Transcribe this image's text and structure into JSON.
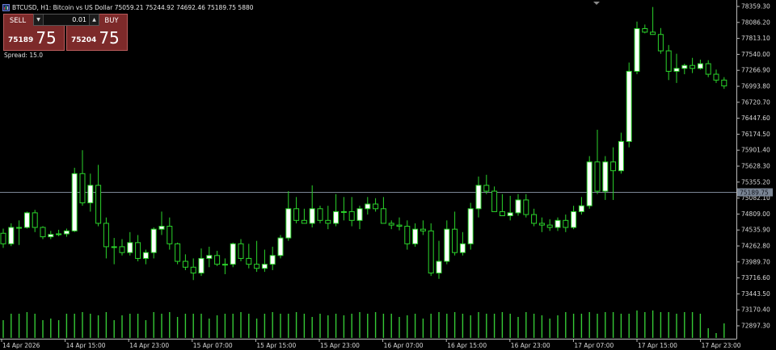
{
  "window": {
    "symbol": "BTCUSD, H1:",
    "description": "Bitcoin vs US Dollar",
    "ohlc": "75059.21 75244.92 74692.46 75189.75",
    "volume": "5880"
  },
  "trade_panel": {
    "sell_label": "SELL",
    "buy_label": "BUY",
    "lot": "0.01",
    "sell_price_small": "75189",
    "sell_price_big": "75",
    "buy_price_small": "75204",
    "buy_price_big": "75",
    "spread": "Spread: 15.0"
  },
  "colors": {
    "background": "#000000",
    "bull_fill": "#ffffff",
    "bear_fill": "#000000",
    "candle_outline": "#2bd42b",
    "volume": "#35c935",
    "price_line": "#7b8695",
    "panel_red": "#7d2a2a"
  },
  "axis": {
    "price_ticks": [
      "78359.30",
      "78086.20",
      "77813.10",
      "77540.00",
      "77266.90",
      "76993.80",
      "76720.70",
      "76447.60",
      "76174.50",
      "75901.40",
      "75628.30",
      "75355.20",
      "75082.10",
      "74809.00",
      "74535.90",
      "74262.80",
      "73989.70",
      "73716.60",
      "73443.50",
      "73170.40",
      "72897.30"
    ],
    "current_price_label": "75189.75",
    "time_labels": [
      "14 Apr 2026",
      "14 Apr 15:00",
      "14 Apr 23:00",
      "15 Apr 07:00",
      "15 Apr 15:00",
      "15 Apr 23:00",
      "16 Apr 07:00",
      "16 Apr 15:00",
      "16 Apr 23:00",
      "17 Apr 07:00",
      "17 Apr 15:00",
      "17 Apr 23:00"
    ]
  },
  "chart_data": {
    "type": "candlestick",
    "timeframe": "H1",
    "current_price": 75189.75,
    "ylim": [
      72897.3,
      78359.3
    ],
    "candles": [
      {
        "o": 74480,
        "h": 74560,
        "l": 74230,
        "c": 74300
      },
      {
        "o": 74300,
        "h": 74650,
        "l": 74260,
        "c": 74580
      },
      {
        "o": 74580,
        "h": 74700,
        "l": 74280,
        "c": 74580
      },
      {
        "o": 74580,
        "h": 74850,
        "l": 74560,
        "c": 74830
      },
      {
        "o": 74830,
        "h": 74880,
        "l": 74500,
        "c": 74580
      },
      {
        "o": 74580,
        "h": 74600,
        "l": 74380,
        "c": 74420
      },
      {
        "o": 74420,
        "h": 74520,
        "l": 74380,
        "c": 74460
      },
      {
        "o": 74460,
        "h": 74540,
        "l": 74430,
        "c": 74470
      },
      {
        "o": 74470,
        "h": 74560,
        "l": 74420,
        "c": 74520
      },
      {
        "o": 74520,
        "h": 75600,
        "l": 74500,
        "c": 75500
      },
      {
        "o": 75500,
        "h": 75900,
        "l": 74950,
        "c": 75000
      },
      {
        "o": 75000,
        "h": 75500,
        "l": 74850,
        "c": 75300
      },
      {
        "o": 75300,
        "h": 75650,
        "l": 74600,
        "c": 74650
      },
      {
        "o": 74650,
        "h": 74750,
        "l": 74050,
        "c": 74250
      },
      {
        "o": 74250,
        "h": 74400,
        "l": 73950,
        "c": 74250
      },
      {
        "o": 74250,
        "h": 74380,
        "l": 74100,
        "c": 74150
      },
      {
        "o": 74150,
        "h": 74500,
        "l": 74100,
        "c": 74320
      },
      {
        "o": 74320,
        "h": 74450,
        "l": 74000,
        "c": 74050
      },
      {
        "o": 74050,
        "h": 74200,
        "l": 73950,
        "c": 74150
      },
      {
        "o": 74150,
        "h": 74580,
        "l": 74050,
        "c": 74550
      },
      {
        "o": 74550,
        "h": 74850,
        "l": 74450,
        "c": 74600
      },
      {
        "o": 74600,
        "h": 74750,
        "l": 74200,
        "c": 74300
      },
      {
        "o": 74300,
        "h": 74320,
        "l": 73950,
        "c": 74000
      },
      {
        "o": 74000,
        "h": 74120,
        "l": 73850,
        "c": 73900
      },
      {
        "o": 73900,
        "h": 74050,
        "l": 73680,
        "c": 73800
      },
      {
        "o": 73800,
        "h": 74220,
        "l": 73750,
        "c": 74050
      },
      {
        "o": 74050,
        "h": 74250,
        "l": 73900,
        "c": 74100
      },
      {
        "o": 74100,
        "h": 74180,
        "l": 73920,
        "c": 73950
      },
      {
        "o": 73950,
        "h": 74050,
        "l": 73780,
        "c": 73950
      },
      {
        "o": 73950,
        "h": 74320,
        "l": 73900,
        "c": 74300
      },
      {
        "o": 74300,
        "h": 74380,
        "l": 74000,
        "c": 74050
      },
      {
        "o": 74050,
        "h": 74300,
        "l": 73880,
        "c": 73950
      },
      {
        "o": 73950,
        "h": 74350,
        "l": 73820,
        "c": 73880
      },
      {
        "o": 73880,
        "h": 74200,
        "l": 73820,
        "c": 73950
      },
      {
        "o": 73950,
        "h": 74250,
        "l": 73850,
        "c": 74100
      },
      {
        "o": 74100,
        "h": 74450,
        "l": 74050,
        "c": 74400
      },
      {
        "o": 74400,
        "h": 75200,
        "l": 74350,
        "c": 74900
      },
      {
        "o": 74900,
        "h": 75100,
        "l": 74650,
        "c": 74700
      },
      {
        "o": 74700,
        "h": 74900,
        "l": 74650,
        "c": 74650
      },
      {
        "o": 74650,
        "h": 75300,
        "l": 74580,
        "c": 74900
      },
      {
        "o": 74900,
        "h": 74950,
        "l": 74650,
        "c": 74700
      },
      {
        "o": 74700,
        "h": 74950,
        "l": 74550,
        "c": 74650
      },
      {
        "o": 74650,
        "h": 75150,
        "l": 74600,
        "c": 74850
      },
      {
        "o": 74850,
        "h": 75100,
        "l": 74700,
        "c": 74850
      },
      {
        "o": 74850,
        "h": 75100,
        "l": 74600,
        "c": 74700
      },
      {
        "o": 74700,
        "h": 74950,
        "l": 74550,
        "c": 74900
      },
      {
        "o": 74900,
        "h": 75100,
        "l": 74800,
        "c": 74980
      },
      {
        "o": 74980,
        "h": 75080,
        "l": 74850,
        "c": 74900
      },
      {
        "o": 74900,
        "h": 75100,
        "l": 74650,
        "c": 74650
      },
      {
        "o": 74650,
        "h": 74700,
        "l": 74550,
        "c": 74620
      },
      {
        "o": 74620,
        "h": 74750,
        "l": 74530,
        "c": 74600
      },
      {
        "o": 74600,
        "h": 74700,
        "l": 74200,
        "c": 74300
      },
      {
        "o": 74300,
        "h": 74650,
        "l": 74250,
        "c": 74550
      },
      {
        "o": 74550,
        "h": 74700,
        "l": 74450,
        "c": 74520
      },
      {
        "o": 74520,
        "h": 74650,
        "l": 73750,
        "c": 73800
      },
      {
        "o": 73800,
        "h": 74350,
        "l": 73700,
        "c": 74000
      },
      {
        "o": 74000,
        "h": 74700,
        "l": 73950,
        "c": 74550
      },
      {
        "o": 74550,
        "h": 74850,
        "l": 74100,
        "c": 74150
      },
      {
        "o": 74150,
        "h": 74500,
        "l": 74100,
        "c": 74300
      },
      {
        "o": 74300,
        "h": 75000,
        "l": 74200,
        "c": 74900
      },
      {
        "o": 74900,
        "h": 75450,
        "l": 74750,
        "c": 75300
      },
      {
        "o": 75300,
        "h": 75480,
        "l": 75150,
        "c": 75200
      },
      {
        "o": 75200,
        "h": 75280,
        "l": 74850,
        "c": 74850
      },
      {
        "o": 74850,
        "h": 75150,
        "l": 74780,
        "c": 74780
      },
      {
        "o": 74780,
        "h": 75120,
        "l": 74700,
        "c": 74830
      },
      {
        "o": 74830,
        "h": 75150,
        "l": 74780,
        "c": 75050
      },
      {
        "o": 75050,
        "h": 75150,
        "l": 74750,
        "c": 74800
      },
      {
        "o": 74800,
        "h": 74900,
        "l": 74600,
        "c": 74650
      },
      {
        "o": 74650,
        "h": 74750,
        "l": 74500,
        "c": 74620
      },
      {
        "o": 74620,
        "h": 74720,
        "l": 74520,
        "c": 74580
      },
      {
        "o": 74580,
        "h": 74750,
        "l": 74520,
        "c": 74700
      },
      {
        "o": 74700,
        "h": 74800,
        "l": 74500,
        "c": 74580
      },
      {
        "o": 74580,
        "h": 74950,
        "l": 74550,
        "c": 74850
      },
      {
        "o": 74850,
        "h": 75100,
        "l": 74800,
        "c": 74950
      },
      {
        "o": 74950,
        "h": 75800,
        "l": 74900,
        "c": 75700
      },
      {
        "o": 75700,
        "h": 76250,
        "l": 75150,
        "c": 75200
      },
      {
        "o": 75200,
        "h": 75800,
        "l": 75050,
        "c": 75700
      },
      {
        "o": 75700,
        "h": 75950,
        "l": 75050,
        "c": 75550
      },
      {
        "o": 75550,
        "h": 76200,
        "l": 75500,
        "c": 76050
      },
      {
        "o": 76050,
        "h": 77400,
        "l": 75950,
        "c": 77250
      },
      {
        "o": 77250,
        "h": 78100,
        "l": 77200,
        "c": 77980
      },
      {
        "o": 77980,
        "h": 78050,
        "l": 77900,
        "c": 77920
      },
      {
        "o": 77920,
        "h": 78350,
        "l": 77880,
        "c": 77880
      },
      {
        "o": 77880,
        "h": 77990,
        "l": 77550,
        "c": 77600
      },
      {
        "o": 77600,
        "h": 77700,
        "l": 77100,
        "c": 77250
      },
      {
        "o": 77250,
        "h": 77550,
        "l": 77050,
        "c": 77300
      },
      {
        "o": 77300,
        "h": 77380,
        "l": 77200,
        "c": 77350
      },
      {
        "o": 77350,
        "h": 77480,
        "l": 77220,
        "c": 77300
      },
      {
        "o": 77300,
        "h": 77450,
        "l": 77280,
        "c": 77380
      },
      {
        "o": 77380,
        "h": 77440,
        "l": 77150,
        "c": 77200
      },
      {
        "o": 77200,
        "h": 77280,
        "l": 77050,
        "c": 77100
      },
      {
        "o": 77100,
        "h": 77150,
        "l": 76950,
        "c": 77000
      }
    ],
    "volume_levels": [
      0.55,
      0.75,
      0.75,
      0.8,
      0.75,
      0.55,
      0.6,
      0.55,
      0.75,
      0.75,
      0.8,
      0.75,
      0.7,
      0.8,
      0.55,
      0.7,
      0.75,
      0.75,
      0.55,
      0.8,
      0.75,
      0.8,
      0.65,
      0.75,
      0.75,
      0.75,
      0.6,
      0.7,
      0.75,
      0.75,
      0.8,
      0.75,
      0.6,
      0.75,
      0.8,
      0.75,
      0.75,
      0.8,
      0.75,
      0.65,
      0.75,
      0.7,
      0.75,
      0.7,
      0.75,
      0.8,
      0.75,
      0.8,
      0.75,
      0.75,
      0.65,
      0.7,
      0.75,
      0.6,
      0.75,
      0.8,
      0.75,
      0.8,
      0.75,
      0.7,
      0.8,
      0.75,
      0.75,
      0.8,
      0.75,
      0.65,
      0.8,
      0.75,
      0.7,
      0.6,
      0.7,
      0.8,
      0.75,
      0.75,
      0.8,
      0.75,
      0.8,
      0.8,
      0.75,
      0.75,
      0.85,
      0.8,
      0.85,
      0.8,
      0.8,
      0.75,
      0.8,
      0.8,
      0.75,
      0.3,
      0.15,
      0.45
    ]
  }
}
